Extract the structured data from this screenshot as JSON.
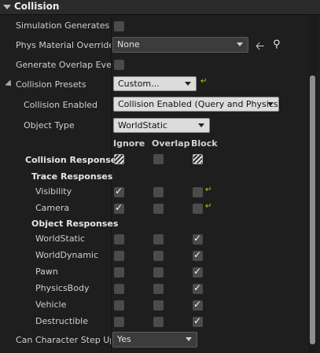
{
  "header": {
    "title": "Collision"
  },
  "properties": {
    "sim_gen_hit_label": "Simulation Generates H",
    "phys_material_label": "Phys Material Override",
    "phys_material_value": "None",
    "gen_overlap_label": "Generate Overlap Event",
    "presets_label": "Collision Presets",
    "presets_value": "Custom...",
    "enabled_label": "Collision Enabled",
    "enabled_value": "Collision Enabled (Query and Physics)",
    "object_type_label": "Object Type",
    "object_type_value": "WorldStatic",
    "step_up_label": "Can Character Step Up O",
    "step_up_value": "Yes"
  },
  "columns": {
    "ignore": "Ignore",
    "overlap": "Overlap",
    "block": "Block"
  },
  "responses": {
    "title": "Collision Responses",
    "trace_title": "Trace Responses",
    "object_title": "Object Responses",
    "trace": [
      {
        "name": "Visibility",
        "ignore": true,
        "overlap": false,
        "block": false
      },
      {
        "name": "Camera",
        "ignore": true,
        "overlap": false,
        "block": false
      }
    ],
    "object": [
      {
        "name": "WorldStatic",
        "ignore": false,
        "overlap": false,
        "block": true
      },
      {
        "name": "WorldDynamic",
        "ignore": false,
        "overlap": false,
        "block": true
      },
      {
        "name": "Pawn",
        "ignore": false,
        "overlap": false,
        "block": true
      },
      {
        "name": "PhysicsBody",
        "ignore": false,
        "overlap": false,
        "block": true
      },
      {
        "name": "Vehicle",
        "ignore": false,
        "overlap": false,
        "block": true
      },
      {
        "name": "Destructible",
        "ignore": false,
        "overlap": false,
        "block": true
      }
    ]
  },
  "colors": {
    "accent_reset": "#d8c800",
    "panel": "#1e1e1e"
  }
}
